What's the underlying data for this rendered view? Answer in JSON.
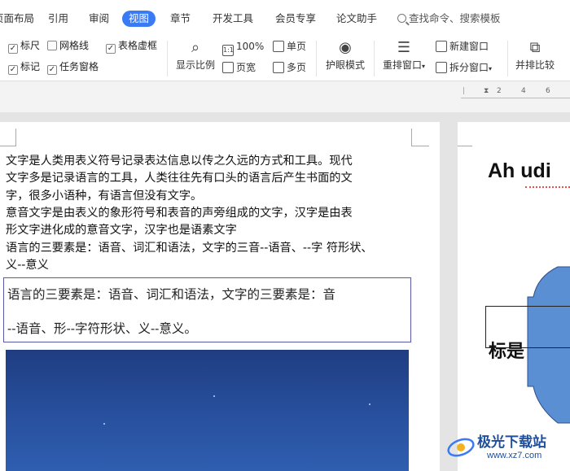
{
  "menu": {
    "tabs": [
      "页面布局",
      "引用",
      "审阅",
      "视图",
      "章节",
      "开发工具",
      "会员专享",
      "论文助手"
    ],
    "active_tab": "视图",
    "search_label": "查找命令、搜索模板"
  },
  "ribbon": {
    "ruler": "标尺",
    "gridlines": "网格线",
    "table_dashed": "表格虚框",
    "marks": "标记",
    "task_pane": "任务窗格",
    "zoom_label": "显示比例",
    "zoom_100": "100%",
    "page_width": "页宽",
    "single_page": "单页",
    "multi_page": "多页",
    "eye_mode": "护眼模式",
    "rearrange": "重排窗口",
    "new_window": "新建窗口",
    "split_window": "拆分窗口",
    "side_by_side": "并排比较"
  },
  "ruler": {
    "ticks": [
      "2",
      "4",
      "6"
    ]
  },
  "document": {
    "paragraph_lines": [
      "文字是人类用表义符号记录表达信息以传之久远的方式和工具。现代",
      "文字多是记录语言的工具，人类往往先有口头的语言后产生书面的文",
      "字，很多小语种，有语言但没有文字。",
      "意音文字是由表义的象形符号和表音的声旁组成的文字，汉字是由表",
      "形文字进化成的意音文字，汉字也是语素文字",
      "语言的三要素是：语音、词汇和语法，文字的三音--语音、--字  符形状、",
      "义--意义"
    ],
    "textbox_lines": [
      "语言的三要素是：语音、词汇和语法，文字的三要素是：音",
      "--语音、形--字符形状、义--意义。"
    ]
  },
  "page2": {
    "heading": "Ah udi",
    "label": "标是"
  },
  "watermark": {
    "brand": "极光下载站",
    "url": "www.xz7.com"
  },
  "colors": {
    "accent": "#3a7bf4",
    "shape_fill": "#5b8fd4",
    "watermark": "#1e4f9c"
  }
}
